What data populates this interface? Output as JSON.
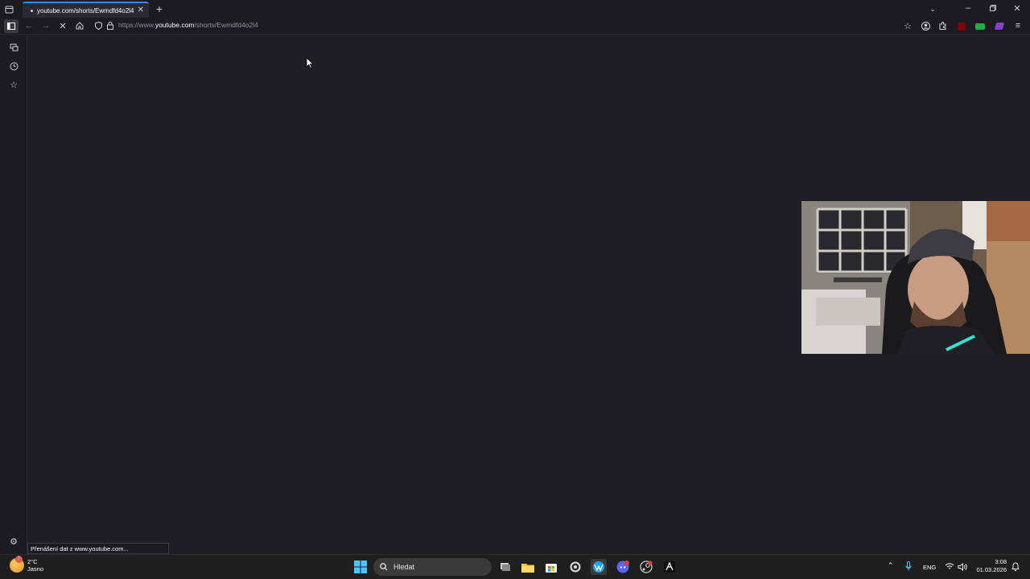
{
  "browser": {
    "tab_title": "youtube.com/shorts/Ewmdfd4o2l4",
    "url_prefix": "https://www.",
    "url_domain": "youtube.com",
    "url_path": "/shorts/Ewmdfd4o2l4",
    "status_text": "Přenášení dat z www.youtube.com...",
    "accent_color": "#3b82f6"
  },
  "taskbar": {
    "weather_temp": "2°C",
    "weather_desc": "Jasno",
    "weather_badge": "!",
    "search_placeholder": "Hledat",
    "language": "ENG",
    "time": "3:08",
    "date": "01.03.2026"
  }
}
